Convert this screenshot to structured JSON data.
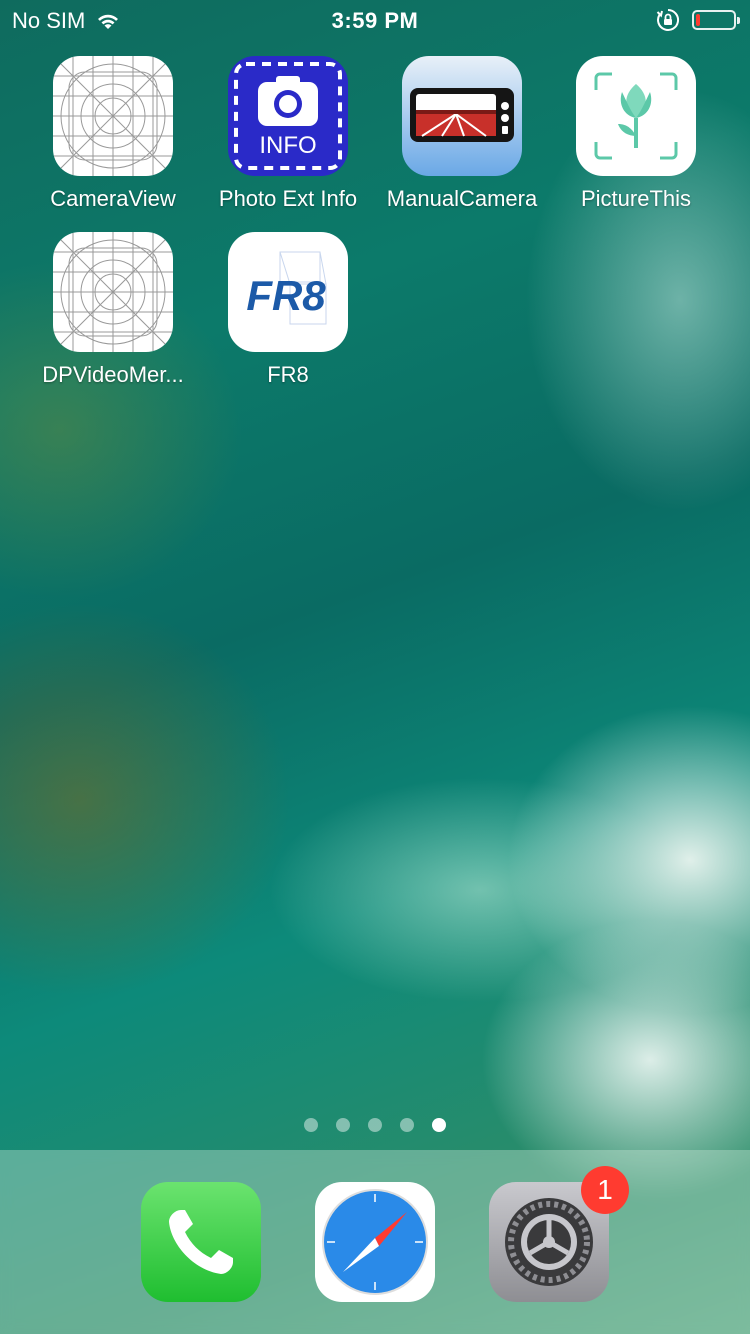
{
  "status_bar": {
    "carrier": "No SIM",
    "time": "3:59 PM",
    "battery_level": 0.1,
    "icons": [
      "wifi-icon",
      "orientation-lock-icon",
      "battery-icon"
    ]
  },
  "apps": [
    {
      "label": "CameraView",
      "icon": "placeholder-grid-icon"
    },
    {
      "label": "Photo Ext Info",
      "icon": "camera-info-icon",
      "icon_text": "INFO"
    },
    {
      "label": "ManualCamera",
      "icon": "manual-camera-icon"
    },
    {
      "label": "PictureThis",
      "icon": "flower-scan-icon"
    },
    {
      "label": "DPVideoMer...",
      "icon": "placeholder-grid-icon"
    },
    {
      "label": "FR8",
      "icon": "fr8-logo-icon",
      "icon_text": "FR8"
    }
  ],
  "page_indicator": {
    "pages": 5,
    "current": 5
  },
  "dock": [
    {
      "name": "Phone",
      "icon": "phone-icon"
    },
    {
      "name": "Safari",
      "icon": "safari-compass-icon"
    },
    {
      "name": "Settings",
      "icon": "gear-icon",
      "badge": "1"
    }
  ],
  "colors": {
    "badge": "#ff3b30",
    "photo_ext_info_bg": "#2a2ac8",
    "phone_green": "#1fbe30"
  }
}
